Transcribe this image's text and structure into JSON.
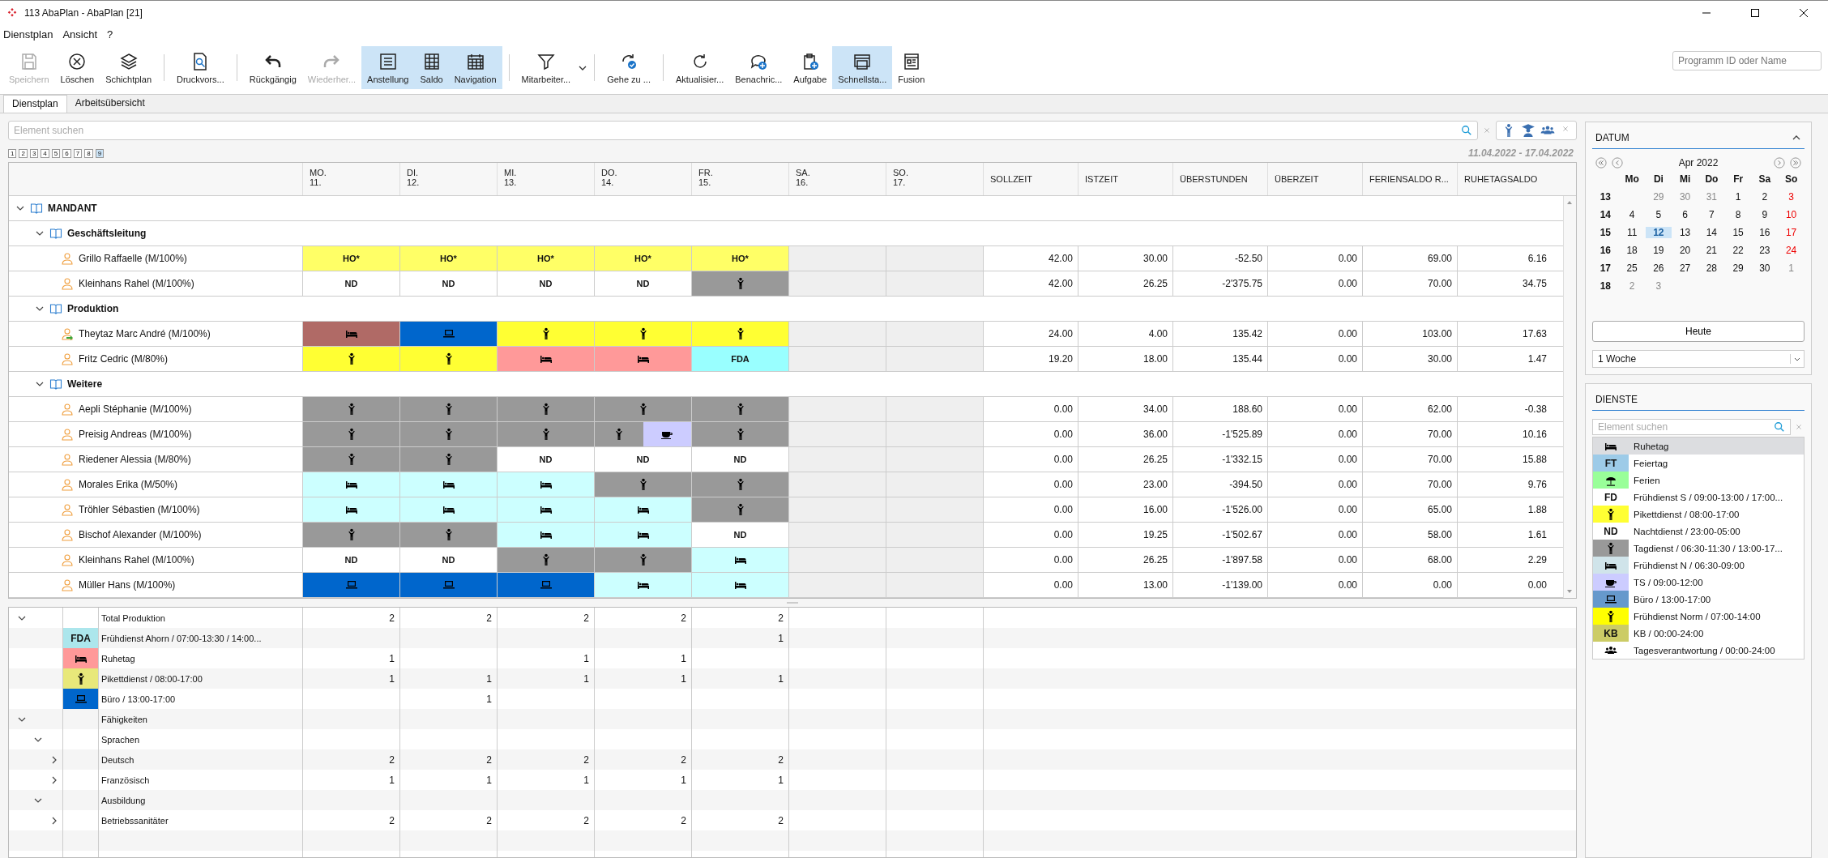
{
  "window": {
    "title": "113 AbaPlan - AbaPlan [21]"
  },
  "menu": [
    "Dienstplan",
    "Ansicht",
    "?"
  ],
  "toolbar": [
    [
      {
        "kind": "save",
        "label": "Speichern",
        "disabled": true,
        "selected": false
      },
      {
        "kind": "delete",
        "label": "Löschen",
        "disabled": false,
        "selected": false
      },
      {
        "kind": "layers",
        "label": "Schichtplan",
        "disabled": false,
        "selected": false
      }
    ],
    [
      {
        "kind": "preview",
        "label": "Druckvors...",
        "disabled": false,
        "selected": false
      }
    ],
    [
      {
        "kind": "undo",
        "label": "Rückgängig",
        "disabled": false,
        "selected": false
      },
      {
        "kind": "redo",
        "label": "Wiederher...",
        "disabled": true,
        "selected": false
      },
      {
        "kind": "document",
        "label": "Anstellung",
        "disabled": false,
        "selected": true
      },
      {
        "kind": "grid",
        "label": "Saldo",
        "disabled": false,
        "selected": true
      },
      {
        "kind": "calendar",
        "label": "Navigation",
        "disabled": false,
        "selected": true
      }
    ],
    [
      {
        "kind": "filter",
        "label": "Mitarbeiter...",
        "disabled": false,
        "selected": false,
        "dropdown": true
      }
    ],
    [
      {
        "kind": "goto",
        "label": "Gehe zu ...",
        "disabled": false,
        "selected": false
      }
    ],
    [
      {
        "kind": "refresh",
        "label": "Aktualisier...",
        "disabled": false,
        "selected": false
      },
      {
        "kind": "message",
        "label": "Benachric...",
        "disabled": false,
        "selected": false
      },
      {
        "kind": "clipboard",
        "label": "Aufgabe",
        "disabled": false,
        "selected": false
      },
      {
        "kind": "windows",
        "label": "Schnellsta...",
        "disabled": false,
        "selected": true
      },
      {
        "kind": "layout",
        "label": "Fusion",
        "disabled": false,
        "selected": false
      }
    ]
  ],
  "program_search": {
    "placeholder": "Programm ID oder Name"
  },
  "tabs": [
    {
      "label": "Dienstplan",
      "selected": true
    },
    {
      "label": "Arbeitsübersicht",
      "selected": false
    }
  ],
  "search": {
    "placeholder": "Element suchen"
  },
  "view_buttons": [
    {
      "kind": "person"
    },
    {
      "kind": "graduate"
    },
    {
      "kind": "group"
    }
  ],
  "pages": [
    {
      "label": "1",
      "selected": false
    },
    {
      "label": "2",
      "selected": false
    },
    {
      "label": "3",
      "selected": false
    },
    {
      "label": "4",
      "selected": false
    },
    {
      "label": "5",
      "selected": false
    },
    {
      "label": "6",
      "selected": false
    },
    {
      "label": "7",
      "selected": false
    },
    {
      "label": "8",
      "selected": false
    },
    {
      "label": "9",
      "selected": true
    }
  ],
  "date_range": "11.04.2022 - 17.04.2022",
  "columns": {
    "days": [
      {
        "weekday": "MO.",
        "day": "11."
      },
      {
        "weekday": "DI.",
        "day": "12."
      },
      {
        "weekday": "MI.",
        "day": "13."
      },
      {
        "weekday": "DO.",
        "day": "14."
      },
      {
        "weekday": "FR.",
        "day": "15."
      },
      {
        "weekday": "SA.",
        "day": "16."
      },
      {
        "weekday": "SO.",
        "day": "17."
      }
    ],
    "values": [
      "SOLLZEIT",
      "ISTZEIT",
      "ÜBERSTUNDEN",
      "ÜBERZEIT",
      "FERIENSALDO R...",
      "RUHETAGSALDO"
    ]
  },
  "tree": {
    "kind": "group",
    "label": "MANDANT",
    "expanded": true,
    "children": [
      {
        "kind": "group",
        "label": "Geschäftsleitung",
        "expanded": true,
        "children": [
          {
            "kind": "person",
            "name": "Grillo Raffaelle (M/100%)",
            "days": [
              {
                "kind": "text",
                "label": "HO*",
                "color": "#ffff66"
              },
              {
                "kind": "text",
                "label": "HO*",
                "color": "#ffff66"
              },
              {
                "kind": "text",
                "label": "HO*",
                "color": "#ffff66"
              },
              {
                "kind": "text",
                "label": "HO*",
                "color": "#ffff66"
              },
              {
                "kind": "text",
                "label": "HO*",
                "color": "#ffff66"
              },
              {
                "kind": "blank",
                "color": "#efefef"
              },
              {
                "kind": "blank",
                "color": "#efefef"
              }
            ],
            "values": [
              "42.00",
              "30.00",
              "-52.50",
              "0.00",
              "69.00",
              "6.16"
            ]
          },
          {
            "kind": "person",
            "name": "Kleinhans Rahel (M/100%)",
            "days": [
              {
                "kind": "text",
                "label": "ND",
                "color": "#ffffff"
              },
              {
                "kind": "text",
                "label": "ND",
                "color": "#ffffff"
              },
              {
                "kind": "text",
                "label": "ND",
                "color": "#ffffff"
              },
              {
                "kind": "text",
                "label": "ND",
                "color": "#ffffff"
              },
              {
                "kind": "person",
                "color": "#999999"
              },
              {
                "kind": "blank",
                "color": "#efefef"
              },
              {
                "kind": "blank",
                "color": "#efefef"
              }
            ],
            "values": [
              "42.00",
              "26.25",
              "-2'375.75",
              "0.00",
              "70.00",
              "34.75"
            ]
          }
        ]
      },
      {
        "kind": "group",
        "label": "Produktion",
        "expanded": true,
        "children": [
          {
            "kind": "person-moved",
            "name": "Theytaz Marc André (M/100%)",
            "days": [
              {
                "kind": "bed",
                "color": "#b06a66"
              },
              {
                "kind": "laptop",
                "color": "#0066cc"
              },
              {
                "kind": "person",
                "color": "#ffff33"
              },
              {
                "kind": "person",
                "color": "#ffff33"
              },
              {
                "kind": "person",
                "color": "#ffff33"
              },
              {
                "kind": "blank",
                "color": "#efefef"
              },
              {
                "kind": "blank",
                "color": "#efefef"
              }
            ],
            "values": [
              "24.00",
              "4.00",
              "135.42",
              "0.00",
              "103.00",
              "17.63"
            ]
          },
          {
            "kind": "person",
            "name": "Fritz Cedric (M/80%)",
            "days": [
              {
                "kind": "person",
                "color": "#ffff33"
              },
              {
                "kind": "person",
                "color": "#ffff33"
              },
              {
                "kind": "bed",
                "color": "#ff9999"
              },
              {
                "kind": "bed",
                "color": "#ff9999"
              },
              {
                "kind": "text",
                "label": "FDA",
                "color": "#99ffff"
              },
              {
                "kind": "blank",
                "color": "#efefef"
              },
              {
                "kind": "blank",
                "color": "#efefef"
              }
            ],
            "values": [
              "19.20",
              "18.00",
              "135.44",
              "0.00",
              "30.00",
              "1.47"
            ]
          }
        ]
      },
      {
        "kind": "group",
        "label": "Weitere",
        "expanded": true,
        "children": [
          {
            "kind": "person",
            "name": "Aepli Stéphanie (M/100%)",
            "days": [
              {
                "kind": "person",
                "color": "#999999"
              },
              {
                "kind": "person",
                "color": "#999999"
              },
              {
                "kind": "person",
                "color": "#999999"
              },
              {
                "kind": "person",
                "color": "#999999"
              },
              {
                "kind": "person",
                "color": "#999999"
              },
              {
                "kind": "blank",
                "color": "#efefef"
              },
              {
                "kind": "blank",
                "color": "#efefef"
              }
            ],
            "values": [
              "0.00",
              "34.00",
              "188.60",
              "0.00",
              "62.00",
              "-0.38"
            ]
          },
          {
            "kind": "person",
            "name": "Preisig Andreas (M/100%)",
            "days": [
              {
                "kind": "person",
                "color": "#999999"
              },
              {
                "kind": "person",
                "color": "#999999"
              },
              {
                "kind": "person",
                "color": "#999999"
              },
              {
                "kind": "split",
                "parts": [
                  {
                    "kind": "person",
                    "color": "#999999"
                  },
                  {
                    "kind": "cup",
                    "color": "#ccccff"
                  }
                ]
              },
              {
                "kind": "person",
                "color": "#999999"
              },
              {
                "kind": "blank",
                "color": "#efefef"
              },
              {
                "kind": "blank",
                "color": "#efefef"
              }
            ],
            "values": [
              "0.00",
              "36.00",
              "-1'525.89",
              "0.00",
              "70.00",
              "10.16"
            ]
          },
          {
            "kind": "person",
            "name": "Riedener Alessia (M/80%)",
            "days": [
              {
                "kind": "person",
                "color": "#999999"
              },
              {
                "kind": "person",
                "color": "#999999"
              },
              {
                "kind": "text",
                "label": "ND",
                "color": "#ffffff"
              },
              {
                "kind": "text",
                "label": "ND",
                "color": "#ffffff"
              },
              {
                "kind": "text",
                "label": "ND",
                "color": "#ffffff"
              },
              {
                "kind": "blank",
                "color": "#efefef"
              },
              {
                "kind": "blank",
                "color": "#efefef"
              }
            ],
            "values": [
              "0.00",
              "26.25",
              "-1'332.15",
              "0.00",
              "70.00",
              "15.88"
            ]
          },
          {
            "kind": "person",
            "name": "Morales Erika (M/50%)",
            "days": [
              {
                "kind": "bed",
                "color": "#ccffff"
              },
              {
                "kind": "bed",
                "color": "#ccffff"
              },
              {
                "kind": "bed",
                "color": "#ccffff"
              },
              {
                "kind": "person",
                "color": "#999999"
              },
              {
                "kind": "person",
                "color": "#999999"
              },
              {
                "kind": "blank",
                "color": "#efefef"
              },
              {
                "kind": "blank",
                "color": "#efefef"
              }
            ],
            "values": [
              "0.00",
              "23.00",
              "-394.50",
              "0.00",
              "70.00",
              "9.76"
            ]
          },
          {
            "kind": "person",
            "name": "Tröhler Sébastien (M/100%)",
            "days": [
              {
                "kind": "bed",
                "color": "#ccffff"
              },
              {
                "kind": "bed",
                "color": "#ccffff"
              },
              {
                "kind": "bed",
                "color": "#ccffff"
              },
              {
                "kind": "bed",
                "color": "#ccffff"
              },
              {
                "kind": "person",
                "color": "#999999"
              },
              {
                "kind": "blank",
                "color": "#efefef"
              },
              {
                "kind": "blank",
                "color": "#efefef"
              }
            ],
            "values": [
              "0.00",
              "16.00",
              "-1'526.00",
              "0.00",
              "65.00",
              "1.88"
            ]
          },
          {
            "kind": "person",
            "name": "Bischof Alexander (M/100%)",
            "days": [
              {
                "kind": "person",
                "color": "#999999"
              },
              {
                "kind": "person",
                "color": "#999999"
              },
              {
                "kind": "bed",
                "color": "#ccffff"
              },
              {
                "kind": "bed",
                "color": "#ccffff"
              },
              {
                "kind": "text",
                "label": "ND",
                "color": "#ffffff"
              },
              {
                "kind": "blank",
                "color": "#efefef"
              },
              {
                "kind": "blank",
                "color": "#efefef"
              }
            ],
            "values": [
              "0.00",
              "19.25",
              "-1'502.67",
              "0.00",
              "58.00",
              "1.61"
            ]
          },
          {
            "kind": "person",
            "name": "Kleinhans Rahel (M/100%)",
            "days": [
              {
                "kind": "text",
                "label": "ND",
                "color": "#ffffff"
              },
              {
                "kind": "text",
                "label": "ND",
                "color": "#ffffff"
              },
              {
                "kind": "person",
                "color": "#999999"
              },
              {
                "kind": "person",
                "color": "#999999"
              },
              {
                "kind": "bed",
                "color": "#ccffff"
              },
              {
                "kind": "blank",
                "color": "#efefef"
              },
              {
                "kind": "blank",
                "color": "#efefef"
              }
            ],
            "values": [
              "0.00",
              "26.25",
              "-1'897.58",
              "0.00",
              "68.00",
              "2.29"
            ]
          },
          {
            "kind": "person",
            "name": "Müller Hans (M/100%)",
            "days": [
              {
                "kind": "laptop",
                "color": "#0066cc"
              },
              {
                "kind": "laptop",
                "color": "#0066cc"
              },
              {
                "kind": "laptop",
                "color": "#0066cc"
              },
              {
                "kind": "bed",
                "color": "#ccffff"
              },
              {
                "kind": "bed",
                "color": "#ccffff"
              },
              {
                "kind": "blank",
                "color": "#efefef"
              },
              {
                "kind": "blank",
                "color": "#efefef"
              }
            ],
            "values": [
              "0.00",
              "13.00",
              "-1'139.00",
              "0.00",
              "0.00",
              "0.00"
            ]
          }
        ]
      }
    ]
  },
  "summary": [
    {
      "label": "Total Produktion",
      "expanded": true,
      "counts": {
        "mo": "2",
        "di": "2",
        "mi": "2",
        "do": "2",
        "fr": "2"
      },
      "children": [
        {
          "label": "Frühdienst Ahorn / 07:00-13:30 / 14:00...",
          "shift": {
            "kind": "text",
            "label": "FDA",
            "color": "#ace6ec"
          },
          "counts": {
            "fr": "1"
          }
        },
        {
          "label": "Ruhetag",
          "shift": {
            "kind": "bed",
            "color": "#ff9999"
          },
          "counts": {
            "mo": "1",
            "mi": "1",
            "do": "1"
          }
        },
        {
          "label": "Pikettdienst / 08:00-17:00",
          "shift": {
            "kind": "person",
            "color": "#e8e87a"
          },
          "counts": {
            "mo": "1",
            "di": "1",
            "mi": "1",
            "do": "1",
            "fr": "1"
          }
        },
        {
          "label": "Büro / 13:00-17:00",
          "shift": {
            "kind": "laptop",
            "color": "#0066cc"
          },
          "counts": {
            "di": "1"
          }
        }
      ]
    },
    {
      "label": "Fähigkeiten",
      "expanded": true,
      "children": [
        {
          "label": "Sprachen",
          "expanded": true,
          "children": [
            {
              "label": "Deutsch",
              "expanded": false,
              "counts": {
                "mo": "2",
                "di": "2",
                "mi": "2",
                "do": "2",
                "fr": "2"
              }
            },
            {
              "label": "Französisch",
              "expanded": false,
              "counts": {
                "mo": "1",
                "di": "1",
                "mi": "1",
                "do": "1",
                "fr": "1"
              }
            }
          ]
        },
        {
          "label": "Ausbildung",
          "expanded": true,
          "children": [
            {
              "label": "Betriebssanitäter",
              "expanded": false,
              "counts": {
                "mo": "2",
                "di": "2",
                "mi": "2",
                "do": "2",
                "fr": "2"
              }
            }
          ]
        }
      ]
    }
  ],
  "calendar": {
    "title": "DATUM",
    "month": "Apr 2022",
    "weekdays": [
      "Mo",
      "Di",
      "Mi",
      "Do",
      "Fr",
      "Sa",
      "So"
    ],
    "weeks": [
      {
        "number": "13",
        "days": [
          {
            "label": "29",
            "other_month": true,
            "red": false,
            "selected": false
          },
          {
            "label": "30",
            "other_month": true,
            "red": false,
            "selected": false
          },
          {
            "label": "31",
            "other_month": true,
            "red": false,
            "selected": false
          },
          {
            "label": "1",
            "other_month": false,
            "red": false,
            "selected": false
          },
          {
            "label": "2",
            "other_month": false,
            "red": false,
            "selected": false
          },
          {
            "label": "3",
            "other_month": false,
            "red": true,
            "selected": false
          }
        ]
      },
      {
        "number": "14",
        "days": [
          {
            "label": "4",
            "other_month": false,
            "red": false,
            "selected": false
          },
          {
            "label": "5",
            "other_month": false,
            "red": false,
            "selected": false
          },
          {
            "label": "6",
            "other_month": false,
            "red": false,
            "selected": false
          },
          {
            "label": "7",
            "other_month": false,
            "red": false,
            "selected": false
          },
          {
            "label": "8",
            "other_month": false,
            "red": false,
            "selected": false
          },
          {
            "label": "9",
            "other_month": false,
            "red": false,
            "selected": false
          },
          {
            "label": "10",
            "other_month": false,
            "red": true,
            "selected": false
          }
        ]
      },
      {
        "number": "15",
        "days": [
          {
            "label": "11",
            "other_month": false,
            "red": false,
            "selected": false
          },
          {
            "label": "12",
            "other_month": false,
            "red": false,
            "selected": true
          },
          {
            "label": "13",
            "other_month": false,
            "red": false,
            "selected": false
          },
          {
            "label": "14",
            "other_month": false,
            "red": false,
            "selected": false
          },
          {
            "label": "15",
            "other_month": false,
            "red": false,
            "selected": false
          },
          {
            "label": "16",
            "other_month": false,
            "red": false,
            "selected": false
          },
          {
            "label": "17",
            "other_month": false,
            "red": true,
            "selected": false
          }
        ]
      },
      {
        "number": "16",
        "days": [
          {
            "label": "18",
            "other_month": false,
            "red": false,
            "selected": false
          },
          {
            "label": "19",
            "other_month": false,
            "red": false,
            "selected": false
          },
          {
            "label": "20",
            "other_month": false,
            "red": false,
            "selected": false
          },
          {
            "label": "21",
            "other_month": false,
            "red": false,
            "selected": false
          },
          {
            "label": "22",
            "other_month": false,
            "red": false,
            "selected": false
          },
          {
            "label": "23",
            "other_month": false,
            "red": false,
            "selected": false
          },
          {
            "label": "24",
            "other_month": false,
            "red": true,
            "selected": false
          }
        ]
      },
      {
        "number": "17",
        "days": [
          {
            "label": "25",
            "other_month": false,
            "red": false,
            "selected": false
          },
          {
            "label": "26",
            "other_month": false,
            "red": false,
            "selected": false
          },
          {
            "label": "27",
            "other_month": false,
            "red": false,
            "selected": false
          },
          {
            "label": "28",
            "other_month": false,
            "red": false,
            "selected": false
          },
          {
            "label": "29",
            "other_month": false,
            "red": false,
            "selected": false
          },
          {
            "label": "30",
            "other_month": false,
            "red": false,
            "selected": false
          },
          {
            "label": "1",
            "other_month": true,
            "red": false,
            "selected": false
          }
        ]
      },
      {
        "number": "18",
        "days": [
          {
            "label": "2",
            "other_month": true,
            "red": false,
            "selected": false
          },
          {
            "label": "3",
            "other_month": true,
            "red": false,
            "selected": false
          }
        ]
      }
    ],
    "today_button": "Heute",
    "range": {
      "value": "1 Woche"
    }
  },
  "services": {
    "title": "DIENSTE",
    "search": {
      "placeholder": "Element suchen"
    },
    "items": [
      {
        "kind": "bed",
        "text": "Ruhetag",
        "selected": true
      },
      {
        "kind": "text",
        "label": "FT",
        "color": "#9dcbe8",
        "text": "Feiertag",
        "selected": false
      },
      {
        "kind": "umbrella",
        "color": "#99ff99",
        "text": "Ferien",
        "selected": false
      },
      {
        "kind": "text",
        "label": "FD",
        "text": "Frühdienst S / 09:00-13:00 / 17:00...",
        "selected": false
      },
      {
        "kind": "person",
        "color": "#ffff33",
        "text": "Pikettdienst / 08:00-17:00",
        "selected": false
      },
      {
        "kind": "text",
        "label": "ND",
        "text": "Nachtdienst / 23:00-05:00",
        "selected": false
      },
      {
        "kind": "person",
        "color": "#999999",
        "text": "Tagdienst / 06:30-11:30 / 13:00-17...",
        "selected": false
      },
      {
        "kind": "bed",
        "color": "#d0e4ea",
        "text": "Frühdienst N / 06:30-09:00",
        "selected": false
      },
      {
        "kind": "cup",
        "color": "#ccccff",
        "text": "TS / 09:00-12:00",
        "selected": false
      },
      {
        "kind": "laptop",
        "color": "#6699cc",
        "text": "Büro / 13:00-17:00",
        "selected": false
      },
      {
        "kind": "person",
        "color": "#ffff00",
        "text": "Frühdienst Norm / 07:00-14:00",
        "selected": false
      },
      {
        "kind": "text",
        "label": "KB",
        "color": "#cccc66",
        "text": "KB / 00:00-24:00",
        "selected": false
      },
      {
        "kind": "group",
        "text": "Tagesverantwortung / 00:00-24:00",
        "selected": false
      }
    ]
  }
}
